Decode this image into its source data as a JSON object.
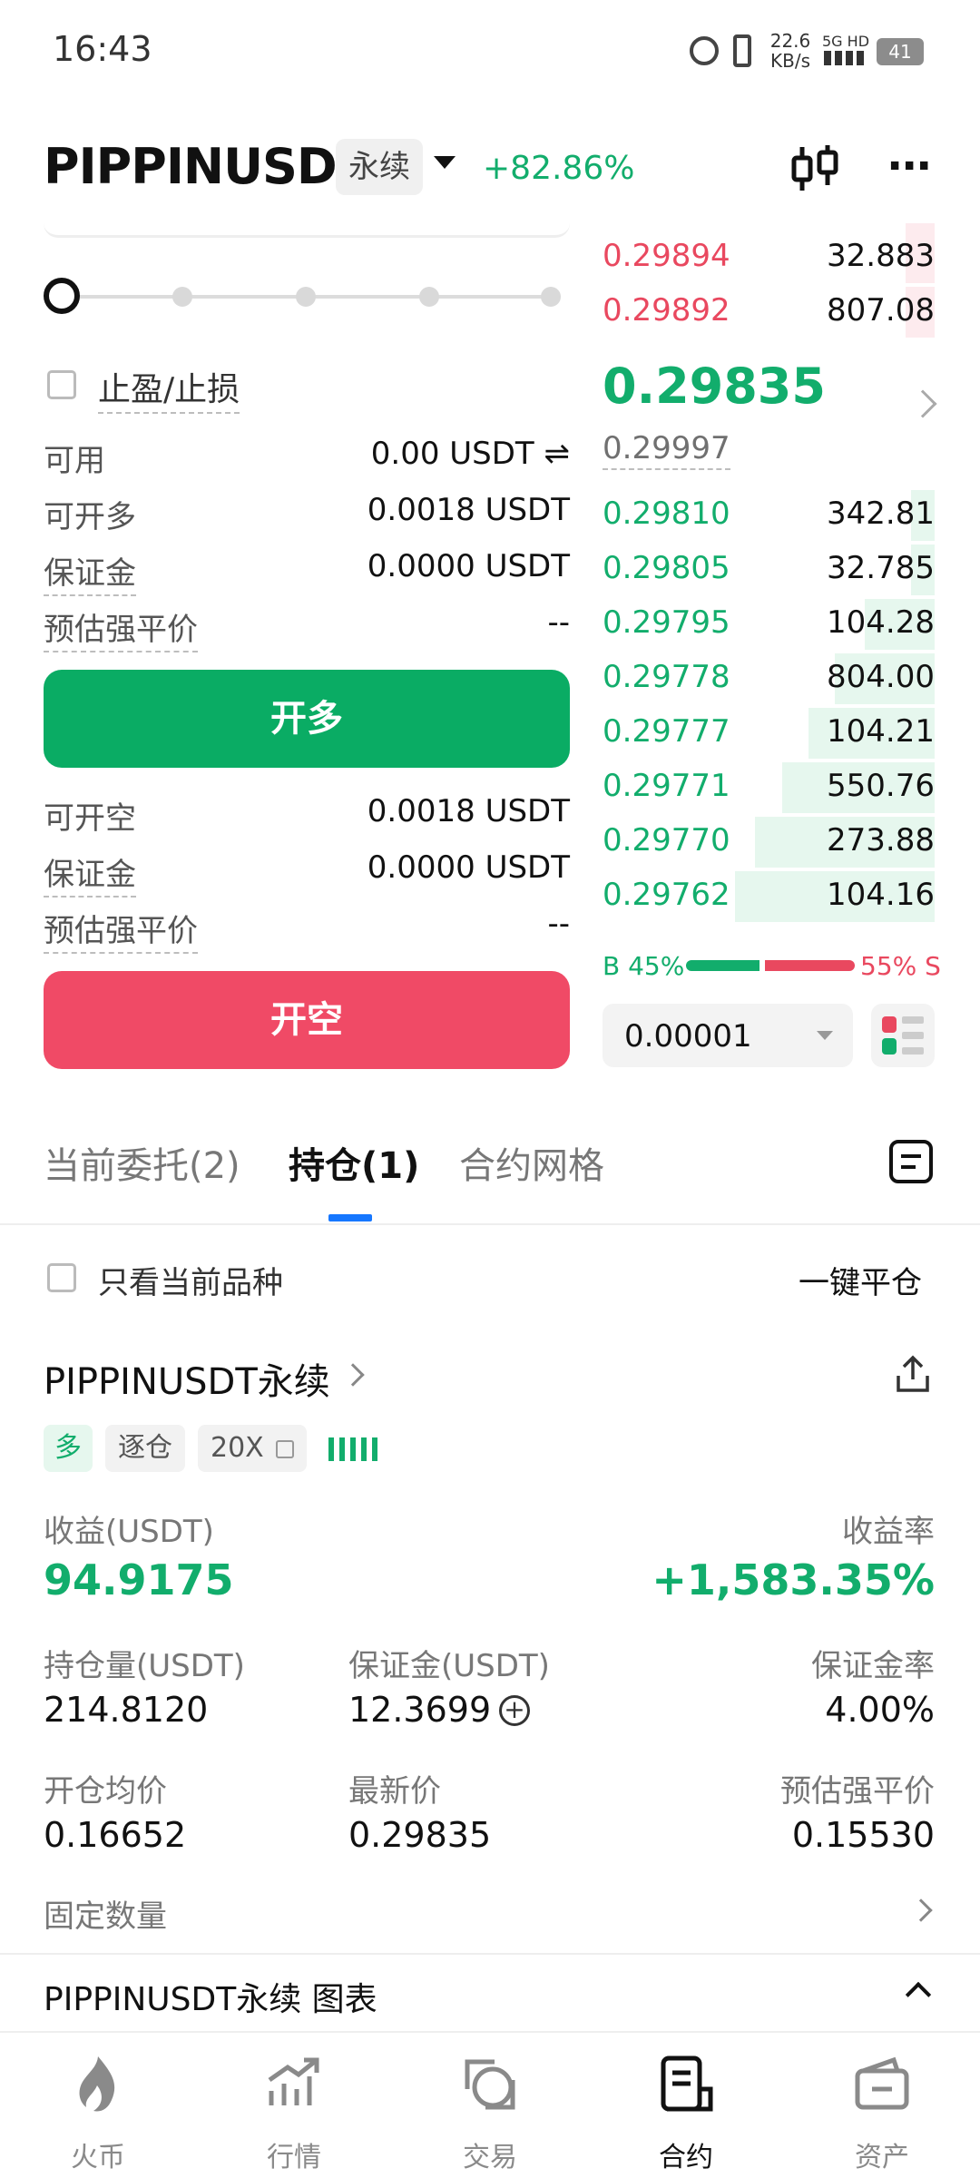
{
  "status_bar": {
    "time": "16:43",
    "speed": "22.6",
    "speed_unit": "KB/s",
    "network": "5G HD",
    "battery": "41"
  },
  "header": {
    "pair": "PIPPINUSDT",
    "contract_type": "永续",
    "change": "+82.86%"
  },
  "form": {
    "tp_sl_label": "止盈/止损",
    "available_label": "可用",
    "available_value": "0.00 USDT",
    "long": {
      "max_label": "可开多",
      "max_value": "0.0018 USDT",
      "margin_label": "保证金",
      "margin_value": "0.0000 USDT",
      "liq_label": "预估强平价",
      "liq_value": "--",
      "button": "开多"
    },
    "short": {
      "max_label": "可开空",
      "max_value": "0.0018 USDT",
      "margin_label": "保证金",
      "margin_value": "0.0000 USDT",
      "liq_label": "预估强平价",
      "liq_value": "--",
      "button": "开空"
    }
  },
  "orderbook": {
    "asks": [
      {
        "price": "0.29894",
        "qty": "32.883",
        "depth": 0.1
      },
      {
        "price": "0.29892",
        "qty": "807.08",
        "depth": 0.1
      }
    ],
    "last_price": "0.29835",
    "mark_price": "0.29997",
    "bids": [
      {
        "price": "0.29810",
        "qty": "342.81",
        "depth": 0.07
      },
      {
        "price": "0.29805",
        "qty": "32.785",
        "depth": 0.07
      },
      {
        "price": "0.29795",
        "qty": "104.28",
        "depth": 0.21
      },
      {
        "price": "0.29778",
        "qty": "804.00",
        "depth": 0.3
      },
      {
        "price": "0.29777",
        "qty": "104.21",
        "depth": 0.38
      },
      {
        "price": "0.29771",
        "qty": "550.76",
        "depth": 0.46
      },
      {
        "price": "0.29770",
        "qty": "273.88",
        "depth": 0.54
      },
      {
        "price": "0.29762",
        "qty": "104.16",
        "depth": 0.6
      }
    ],
    "buy_ratio": "B 45%",
    "sell_ratio": "55% S",
    "buy_fraction": 0.45,
    "precision": "0.00001"
  },
  "tabs": {
    "orders": "当前委托(2)",
    "positions": "持仓(1)",
    "grid": "合约网格"
  },
  "filter": {
    "only_current": "只看当前品种",
    "close_all": "一键平仓"
  },
  "position": {
    "title": "PIPPINUSDT永续",
    "side": "多",
    "margin_mode": "逐仓",
    "leverage": "20X",
    "pnl_label": "收益(USDT)",
    "pnl": "94.9175",
    "roe_label": "收益率",
    "roe": "+1,583.35%",
    "size_label": "持仓量(USDT)",
    "size": "214.8120",
    "margin_label": "保证金(USDT)",
    "margin": "12.3699",
    "margin_rate_label": "保证金率",
    "margin_rate": "4.00%",
    "entry_label": "开仓均价",
    "entry": "0.16652",
    "last_label": "最新价",
    "last": "0.29835",
    "liq_label": "预估强平价",
    "liq": "0.15530",
    "fixed_qty": "固定数量"
  },
  "chart_section": {
    "title": "PIPPINUSDT永续 图表"
  },
  "nav": {
    "home": "火币",
    "market": "行情",
    "trade": "交易",
    "futures": "合约",
    "assets": "资产"
  },
  "colors": {
    "green": "#12ad6c",
    "red": "#e9485f",
    "tab_accent": "#1677ff"
  }
}
